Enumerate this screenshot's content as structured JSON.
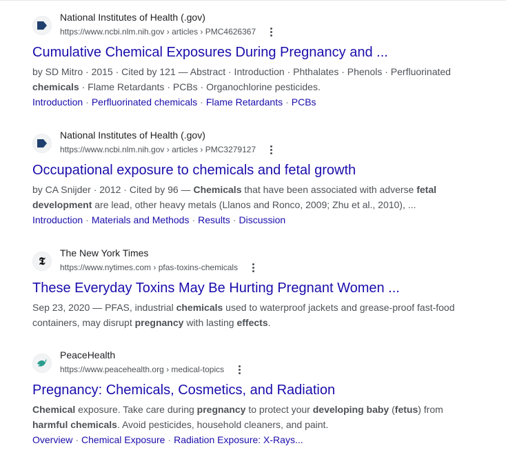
{
  "results": [
    {
      "favicon": "nih-arrow-icon",
      "source": "National Institutes of Health (.gov)",
      "url": "https://www.ncbi.nlm.nih.gov › articles › PMC4626367",
      "title": "Cumulative Chemical Exposures During Pregnancy and ...",
      "snippet_html": "by SD Mitro · 2015 · Cited by 121 — Abstract · Introduction · Phthalates · Phenols · Perfluorinated <b>chemicals</b> · Flame Retardants · PCBs · Organochlorine pesticides.",
      "sitelinks": [
        "Introduction",
        "Perfluorinated chemicals",
        "Flame Retardants",
        "PCBs"
      ]
    },
    {
      "favicon": "nih-arrow-icon",
      "source": "National Institutes of Health (.gov)",
      "url": "https://www.ncbi.nlm.nih.gov › articles › PMC3279127",
      "title": "Occupational exposure to chemicals and fetal growth",
      "snippet_html": "by CA Snijder · 2012 · Cited by 96 — <b>Chemicals</b> that have been associated with adverse <b>fetal development</b> are lead, other heavy metals (Llanos and Ronco, 2009; Zhu et al., 2010), ...",
      "sitelinks": [
        "Introduction",
        "Materials and Methods",
        "Results",
        "Discussion"
      ]
    },
    {
      "favicon": "nyt-t-icon",
      "source": "The New York Times",
      "url": "https://www.nytimes.com › pfas-toxins-chemicals",
      "title": "These Everyday Toxins May Be Hurting Pregnant Women ...",
      "snippet_html": "Sep 23, 2020 — PFAS, industrial <b>chemicals</b> used to waterproof jackets and grease-proof fast-food containers, may disrupt <b>pregnancy</b> with lasting <b>effects</b>.",
      "sitelinks": []
    },
    {
      "favicon": "peacehealth-dove-icon",
      "source": "PeaceHealth",
      "url": "https://www.peacehealth.org › medical-topics",
      "title": "Pregnancy: Chemicals, Cosmetics, and Radiation",
      "snippet_html": "<b>Chemical</b> exposure. Take care during <b>pregnancy</b> to protect your <b>developing baby</b> (<b>fetus</b>) from <b>harmful chemicals</b>. Avoid pesticides, household cleaners, and paint.",
      "sitelinks": [
        "Overview",
        "Chemical Exposure",
        "Radiation Exposure: X-Rays..."
      ]
    }
  ],
  "colors": {
    "link": "#1a0dab",
    "text": "#4d5156",
    "source": "#202124",
    "nih_blue": "#20558a",
    "peacehealth_teal": "#2a9d8f"
  }
}
